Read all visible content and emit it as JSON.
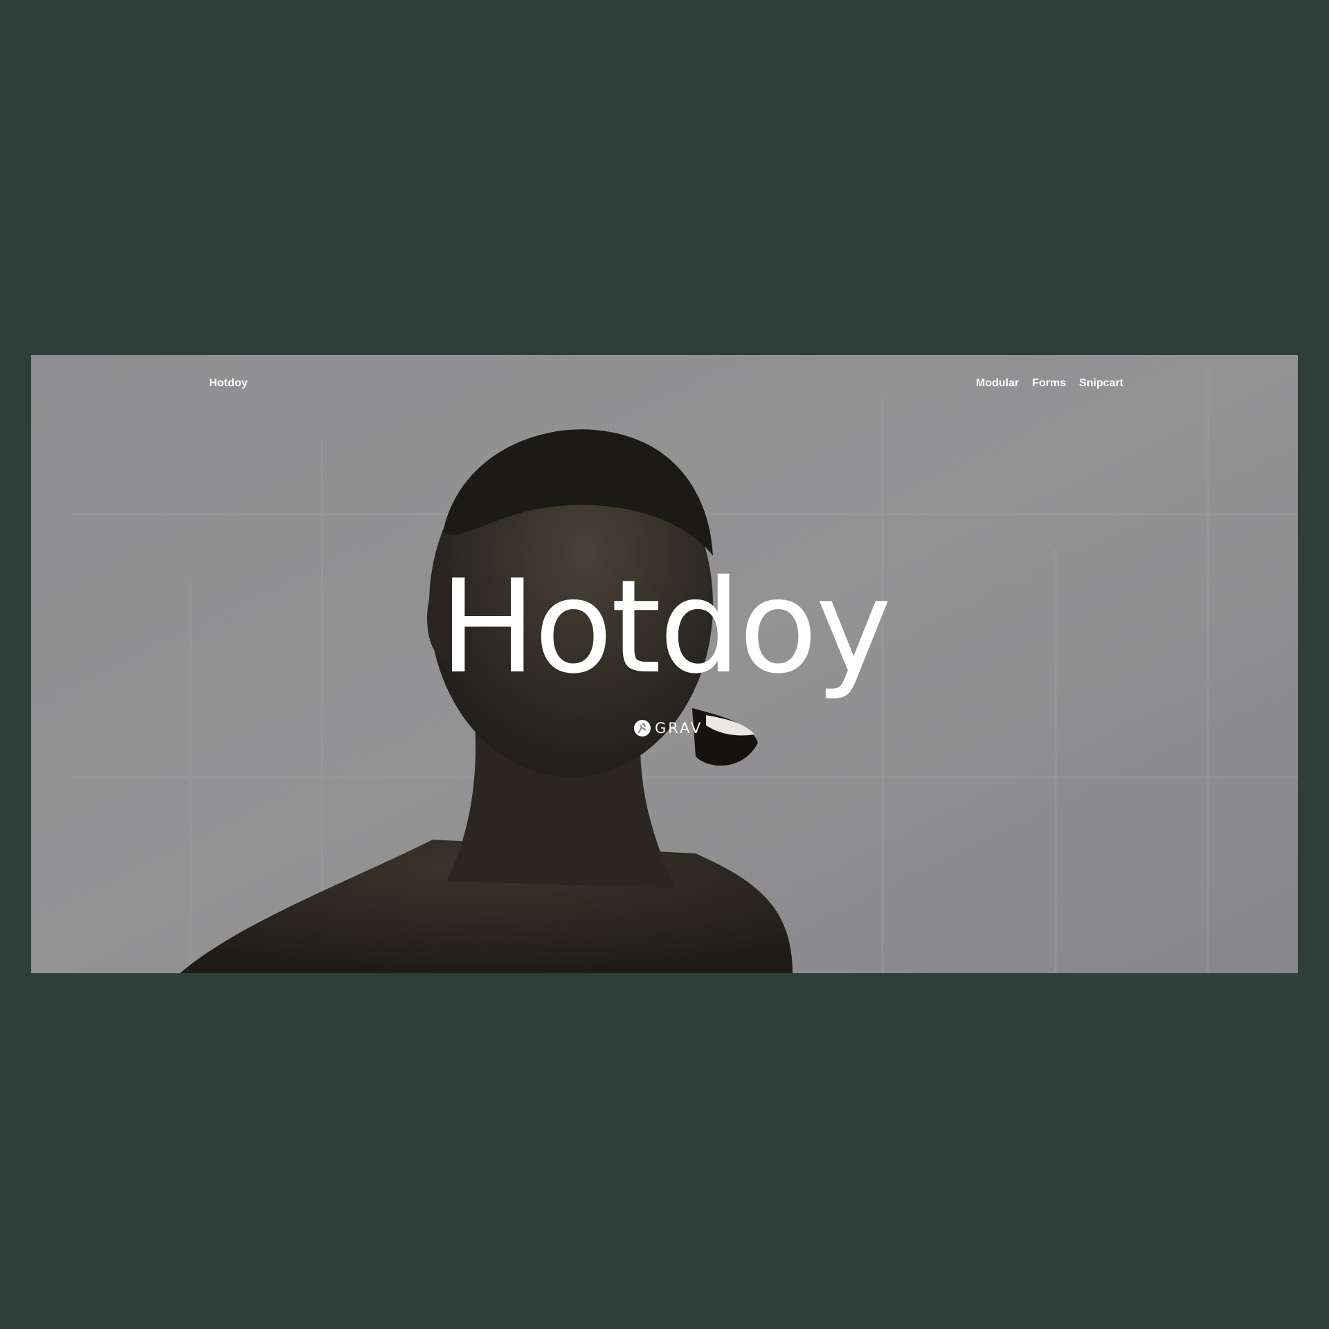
{
  "site": {
    "brand": "Hotdoy",
    "nav": [
      {
        "label": "Modular"
      },
      {
        "label": "Forms"
      },
      {
        "label": "Snipcart"
      }
    ]
  },
  "hero": {
    "title": "Hotdoy",
    "powered_by": "GRAV",
    "powered_by_icon": "grav-logo-icon"
  },
  "colors": {
    "page_background": "#2f3e39",
    "hero_overlay": "#8d8d8f",
    "text": "#ffffff"
  }
}
